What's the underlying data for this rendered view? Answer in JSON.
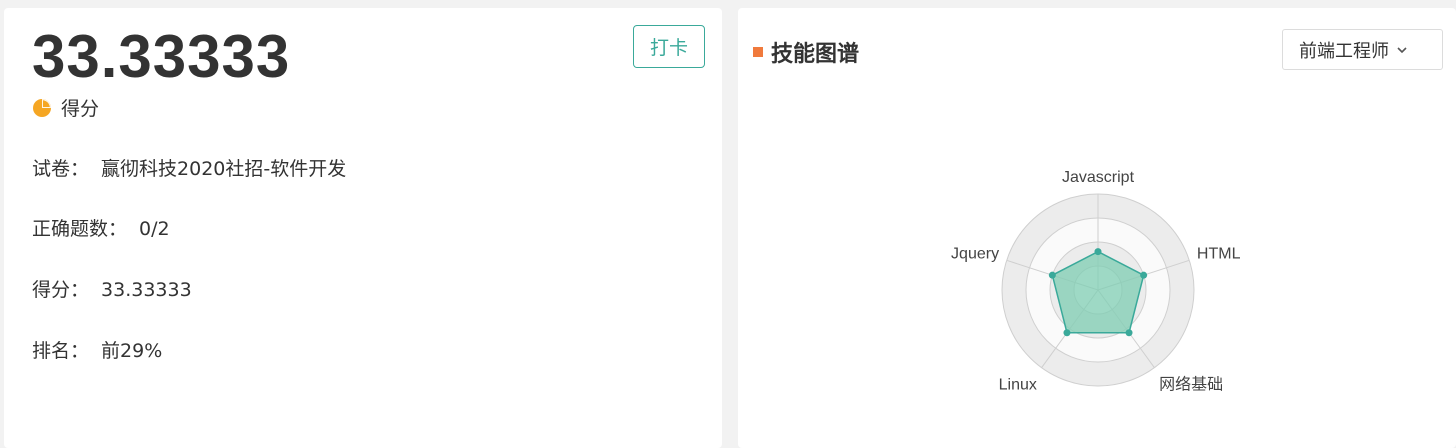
{
  "result": {
    "score_big": "33.33333",
    "score_label": "得分",
    "punch_button": "打卡",
    "rows": [
      {
        "key": "试卷：",
        "value": "赢彻科技2020社招-软件开发"
      },
      {
        "key": "正确题数：",
        "value": "0/2"
      },
      {
        "key": "得分：",
        "value": "33.33333"
      },
      {
        "key": "排名：",
        "value": "前29%"
      }
    ]
  },
  "skills": {
    "title": "技能图谱",
    "role_selected": "前端工程师",
    "colors": {
      "accent": "#3aa99a",
      "fill": "#7fcdb3",
      "title_mark": "#f07a3c"
    }
  },
  "chart_data": {
    "type": "radar",
    "axes": [
      "Javascript",
      "HTML",
      "网络基础",
      "Linux",
      "Jquery"
    ],
    "values": [
      0.4,
      0.5,
      0.55,
      0.55,
      0.5
    ],
    "max": 1,
    "rings": 4
  }
}
